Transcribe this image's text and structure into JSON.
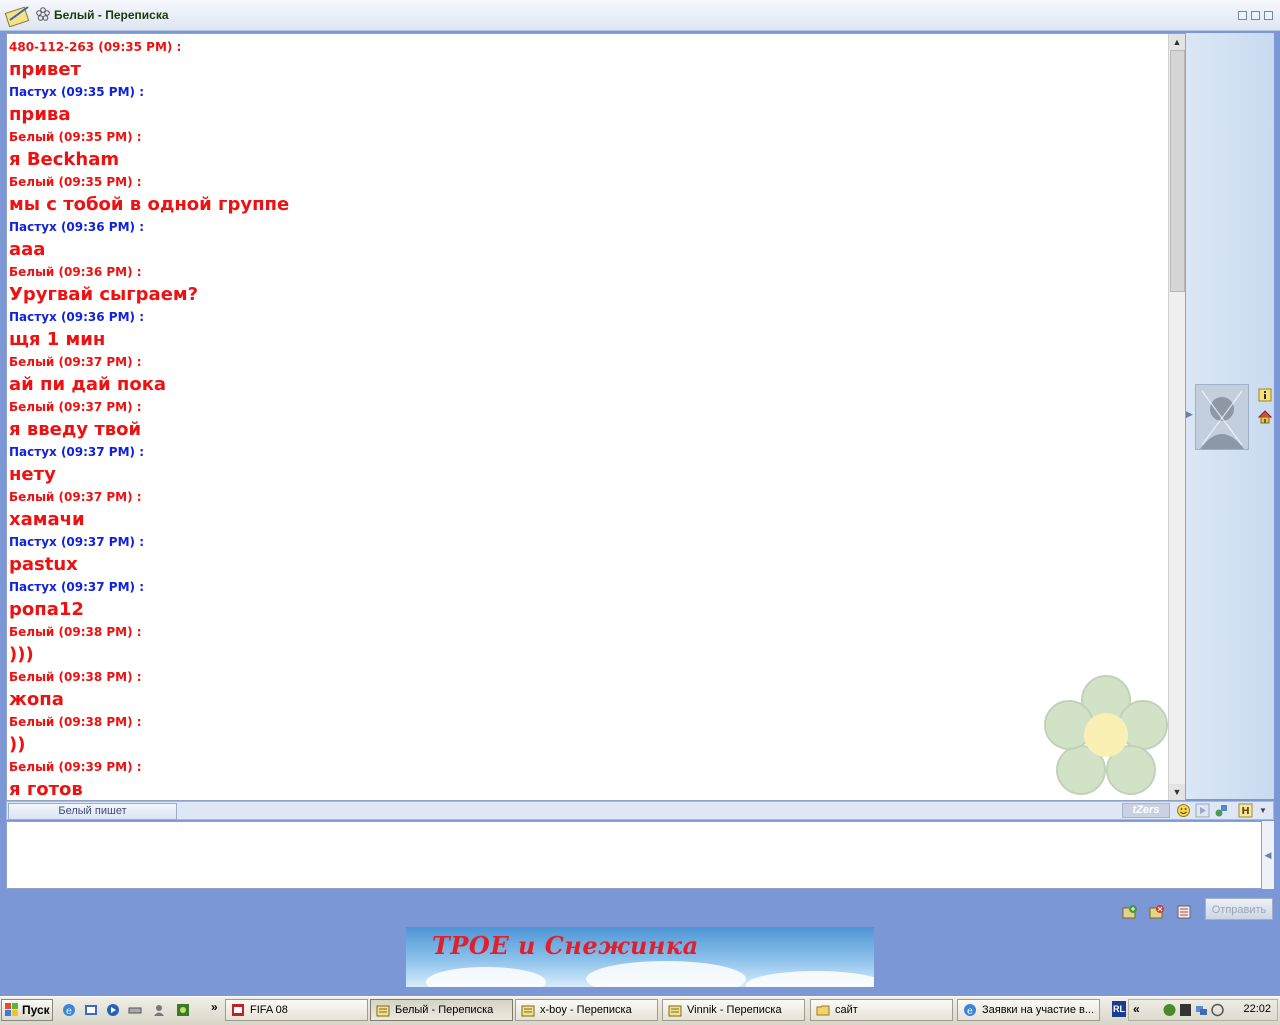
{
  "window": {
    "title": "Белый - Переписка"
  },
  "messages": [
    {
      "author": "480-112-263 (09:35 PM) :",
      "color": "red",
      "text": "привет"
    },
    {
      "author": "Пастух (09:35 PM) :",
      "color": "blue",
      "text": "прива"
    },
    {
      "author": "Белый (09:35 PM) :",
      "color": "red",
      "text": "я Beckham"
    },
    {
      "author": "Белый (09:35 PM) :",
      "color": "red",
      "text": "мы с тобой в одной группе"
    },
    {
      "author": "Пастух (09:36 PM) :",
      "color": "blue",
      "text": "ааа"
    },
    {
      "author": "Белый (09:36 PM) :",
      "color": "red",
      "text": "Уругвай сыграем?"
    },
    {
      "author": "Пастух (09:36 PM) :",
      "color": "blue",
      "text": "щя 1 мин"
    },
    {
      "author": "Белый (09:37 PM) :",
      "color": "red",
      "text": "ай пи дай пока"
    },
    {
      "author": "Белый (09:37 PM) :",
      "color": "red",
      "text": "я введу твой"
    },
    {
      "author": "Пастух (09:37 PM) :",
      "color": "blue",
      "text": "нету"
    },
    {
      "author": "Белый (09:37 PM) :",
      "color": "red",
      "text": "хамачи"
    },
    {
      "author": "Пастух (09:37 PM) :",
      "color": "blue",
      "text": "pastux"
    },
    {
      "author": "Пастух (09:37 PM) :",
      "color": "blue",
      "text": "ропа12"
    },
    {
      "author": "Белый (09:38 PM) :",
      "color": "red",
      "text": ")))"
    },
    {
      "author": "Белый (09:38 PM) :",
      "color": "red",
      "text": "жопа"
    },
    {
      "author": "Белый (09:38 PM) :",
      "color": "red",
      "text": "))"
    },
    {
      "author": "Белый (09:39 PM) :",
      "color": "red",
      "text": "я готов"
    }
  ],
  "status": {
    "typing": "Белый пишет",
    "tzers_label": "tZers"
  },
  "input": {
    "value": ""
  },
  "actions": {
    "send_label": "Отправить"
  },
  "banner": {
    "text": "ТРОЕ и Снежинка"
  },
  "taskbar": {
    "start_label": "Пуск",
    "more_glyph": "»",
    "tasks": [
      {
        "label": "FIFA 08"
      },
      {
        "label": "Белый - Переписка"
      },
      {
        "label": "x-boy - Переписка"
      },
      {
        "label": "Vinnik - Переписка"
      },
      {
        "label": "сайт"
      },
      {
        "label": "Заявки на участие в..."
      }
    ],
    "lang": "RL",
    "tray_chevron": "«",
    "clock": "22:02"
  },
  "colors": {
    "author_red": "#ee1111",
    "author_blue": "#1122dd",
    "accent": "#7b97d6"
  }
}
